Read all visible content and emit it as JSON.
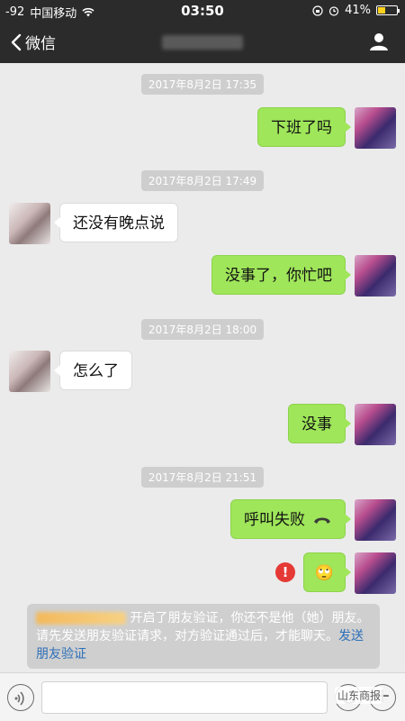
{
  "status_bar": {
    "signal": "-92",
    "carrier": "中国移动",
    "time": "03:50",
    "battery": "41%",
    "battery_level": 0.41
  },
  "nav": {
    "back_label": "微信"
  },
  "messages": {
    "t1": "2017年8月2日 17:35",
    "m1": "下班了吗",
    "t2": "2017年8月2日 17:49",
    "m2": "还没有晚点说",
    "m3": "没事了，你忙吧",
    "t3": "2017年8月2日 18:00",
    "m4": "怎么了",
    "m5": "没事",
    "t4": "2017年8月2日 21:51",
    "m6": "呼叫失败",
    "m7_emoji": "🙄"
  },
  "notice": {
    "text": "开启了朋友验证，你还不是他（她）朋友。请先发送朋友验证请求，对方验证通过后，才能聊天。",
    "link": "发送朋友验证"
  },
  "input_bar": {
    "plus": "+"
  },
  "watermark": "山东商报",
  "colors": {
    "my_bubble": "#9fe65a",
    "other_bubble": "#ffffff",
    "header": "#2b2b2b",
    "error": "#e53935",
    "link": "#2d6fb8"
  }
}
